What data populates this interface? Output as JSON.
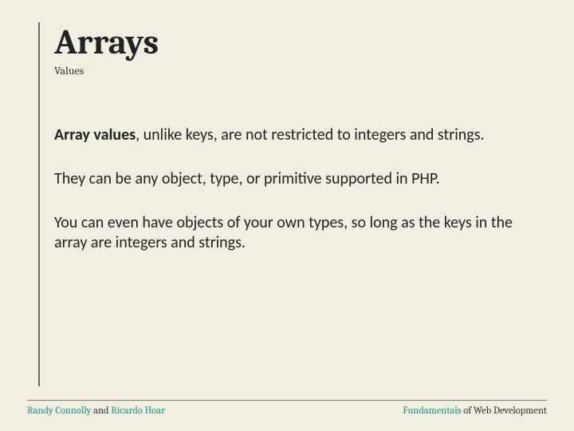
{
  "header": {
    "title": "Arrays",
    "subtitle": "Values"
  },
  "body": {
    "p1_lead": "Array values",
    "p1_rest": ", unlike keys, are not restricted to integers and strings.",
    "p2": "They can be any object, type, or primitive supported in PHP.",
    "p3": "You can even have objects of your own types, so long as the keys in the array are integers and strings."
  },
  "footer": {
    "author1": "Randy Connolly",
    "join": " and ",
    "author2": "Ricardo Hoar",
    "book_hl": "Fundamentals",
    "book_rest": " of Web Development"
  }
}
